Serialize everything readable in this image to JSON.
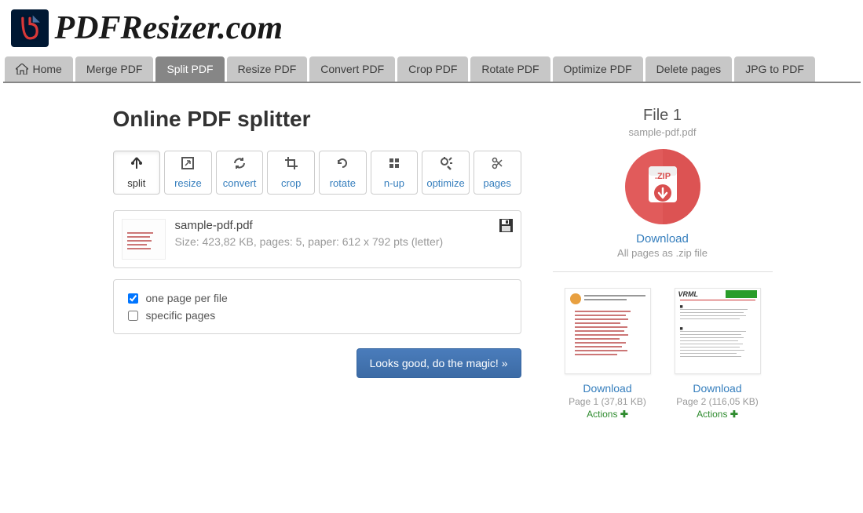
{
  "site": {
    "name": "PDFResizer.com"
  },
  "nav": {
    "items": [
      {
        "label": "Home"
      },
      {
        "label": "Merge PDF"
      },
      {
        "label": "Split PDF"
      },
      {
        "label": "Resize PDF"
      },
      {
        "label": "Convert PDF"
      },
      {
        "label": "Crop PDF"
      },
      {
        "label": "Rotate PDF"
      },
      {
        "label": "Optimize PDF"
      },
      {
        "label": "Delete pages"
      },
      {
        "label": "JPG to PDF"
      }
    ],
    "active_index": 2
  },
  "page": {
    "title": "Online PDF splitter"
  },
  "tool_tabs": [
    {
      "label": "split"
    },
    {
      "label": "resize"
    },
    {
      "label": "convert"
    },
    {
      "label": "crop"
    },
    {
      "label": "rotate"
    },
    {
      "label": "n-up"
    },
    {
      "label": "optimize"
    },
    {
      "label": "pages"
    }
  ],
  "file": {
    "name": "sample-pdf.pdf",
    "meta": "Size: 423,82 KB, pages: 5, paper: 612 x 792 pts (letter)"
  },
  "options": {
    "one_page_per_file": "one page per file",
    "specific_pages": "specific pages"
  },
  "action": {
    "button": "Looks good, do the magic! »"
  },
  "sidebar": {
    "file_title": "File 1",
    "file_name": "sample-pdf.pdf",
    "zip": {
      "download_label": "Download",
      "sub": "All pages as .zip file"
    },
    "pages": [
      {
        "download": "Download",
        "meta": "Page 1 (37,81 KB)",
        "actions": "Actions"
      },
      {
        "download": "Download",
        "meta": "Page 2 (116,05 KB)",
        "actions": "Actions"
      }
    ]
  }
}
